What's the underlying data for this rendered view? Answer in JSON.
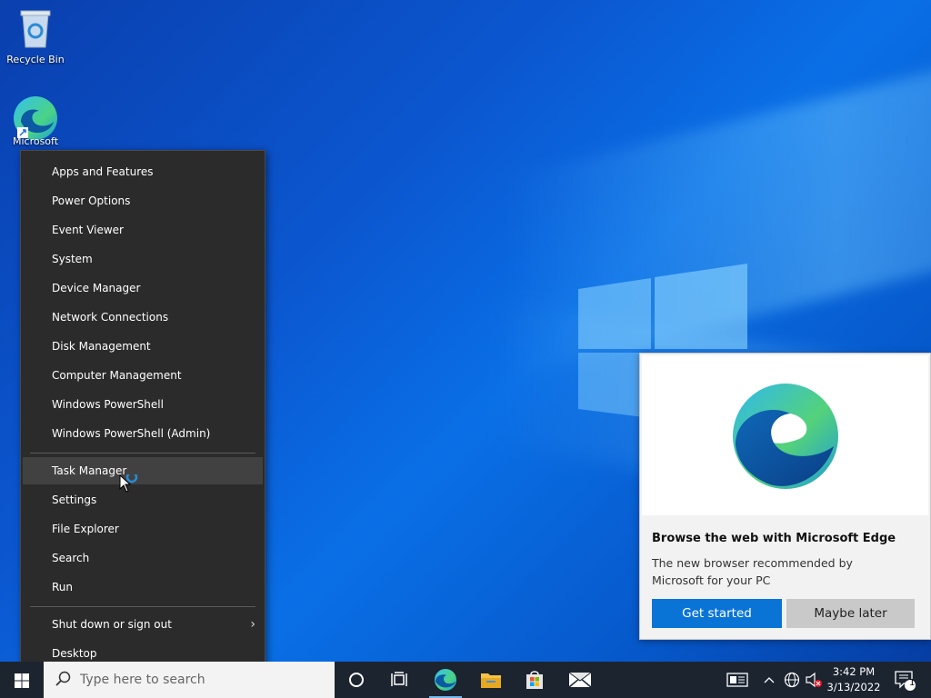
{
  "desktop": {
    "icons": [
      {
        "label": "Recycle Bin"
      },
      {
        "label": "Microsoft"
      }
    ]
  },
  "context_menu": {
    "groups": [
      [
        "Apps and Features",
        "Power Options",
        "Event Viewer",
        "System",
        "Device Manager",
        "Network Connections",
        "Disk Management",
        "Computer Management",
        "Windows PowerShell",
        "Windows PowerShell (Admin)"
      ],
      [
        "Task Manager",
        "Settings",
        "File Explorer",
        "Search",
        "Run"
      ],
      [
        "Shut down or sign out",
        "Desktop"
      ]
    ],
    "hovered_item": "Task Manager"
  },
  "edge_flyout": {
    "title": "Browse the web with Microsoft Edge",
    "description": "The new browser recommended by Microsoft for your PC",
    "primary_button": "Get started",
    "secondary_button": "Maybe later"
  },
  "taskbar": {
    "search_placeholder": "Type here to search",
    "pinned": [
      "cortana-icon",
      "task-view-icon",
      "edge-icon",
      "file-explorer-icon",
      "store-icon",
      "mail-icon"
    ],
    "clock_time": "3:42 PM",
    "clock_date": "3/13/2022",
    "notification_count": "1"
  },
  "colors": {
    "accent": "#0a74d6",
    "menu_bg": "#2b2b2b",
    "taskbar_bg": "#1c2430"
  }
}
